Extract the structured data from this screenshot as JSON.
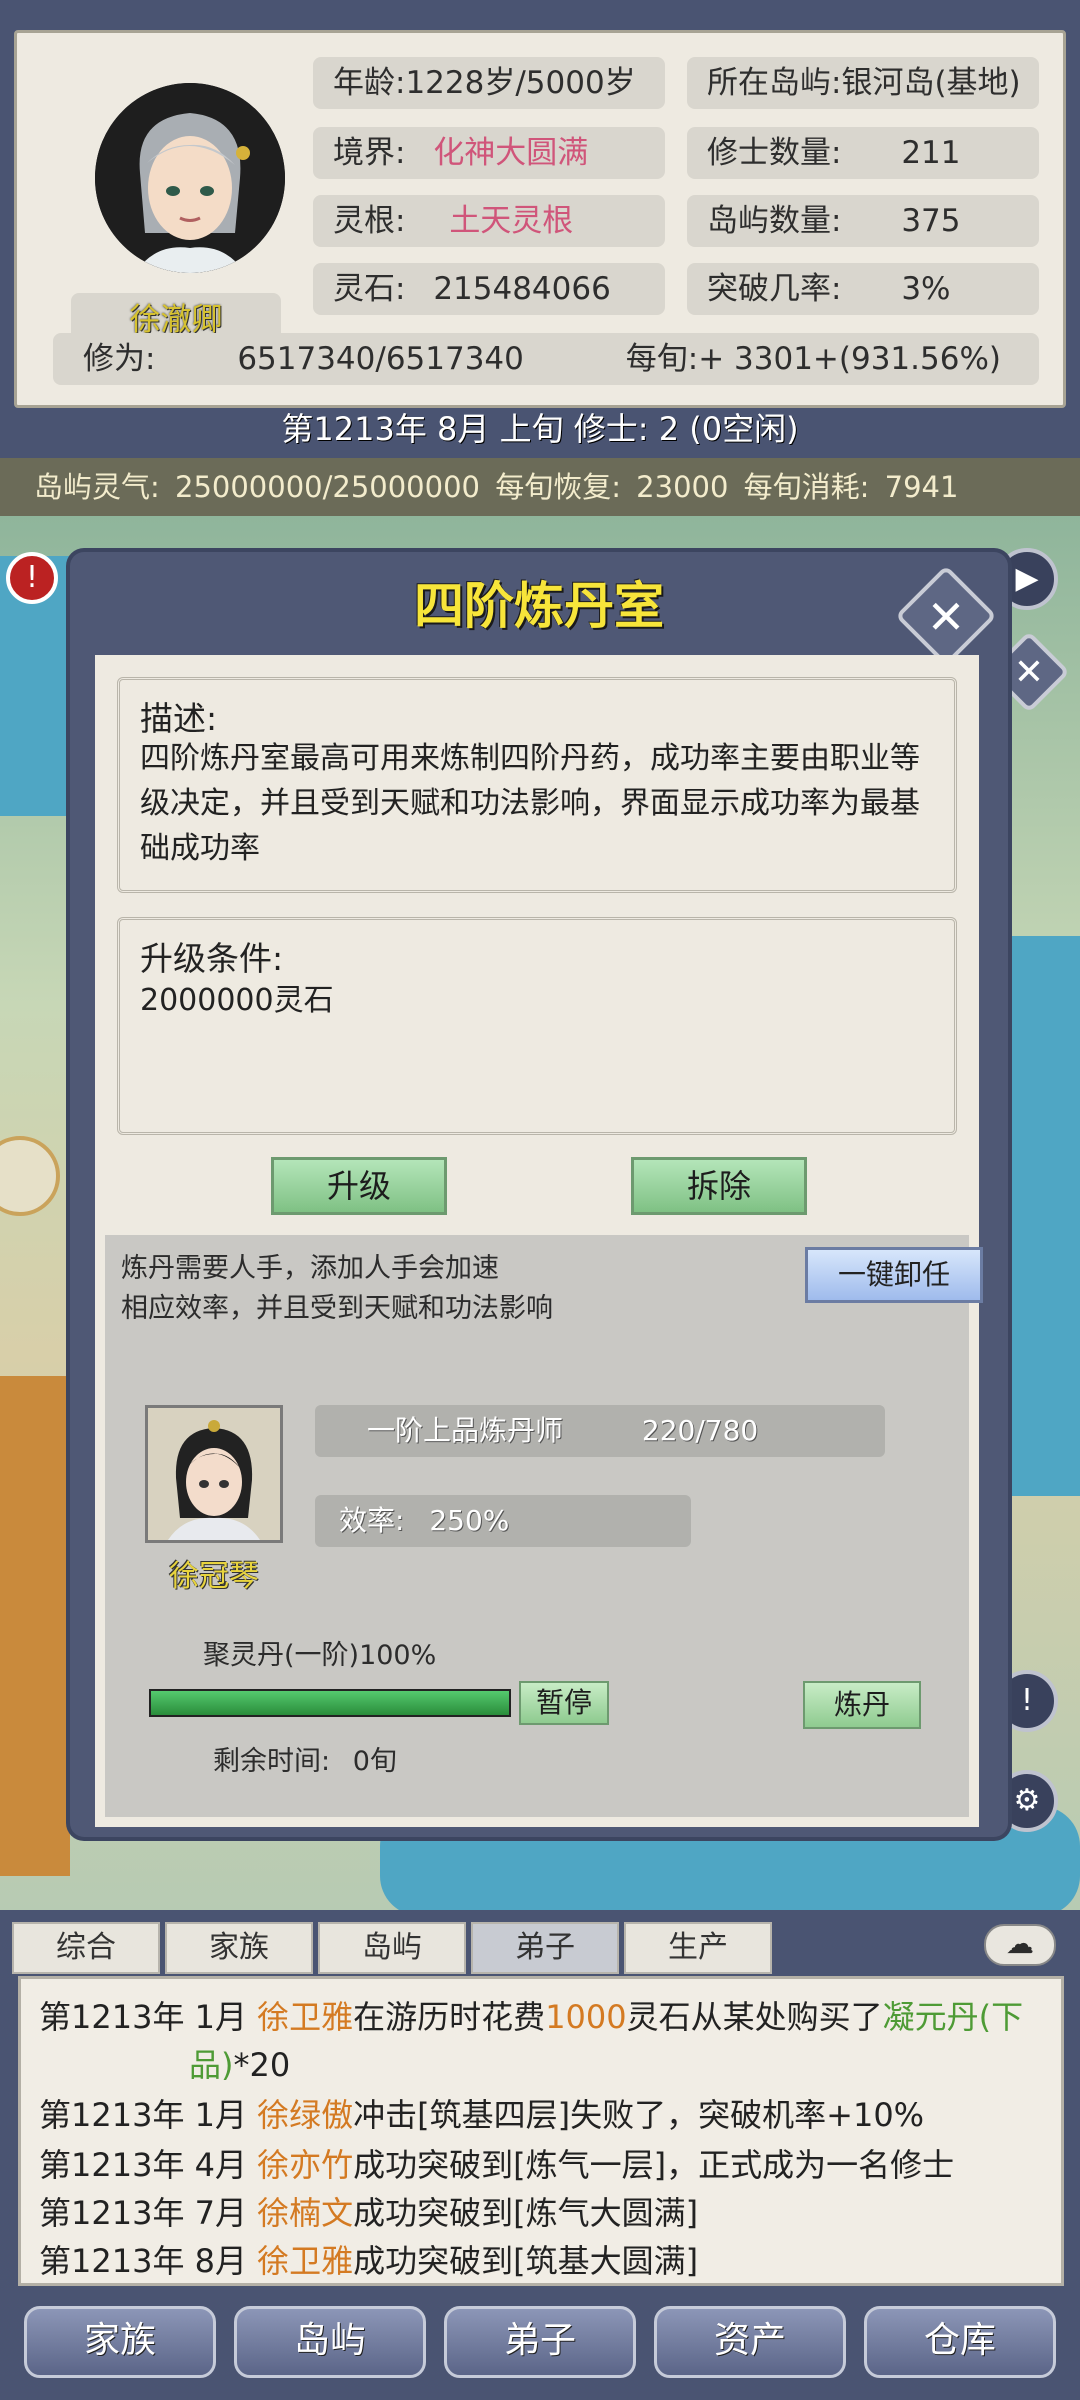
{
  "header": {
    "character_name": "徐澈卿",
    "age": "年龄:1228岁/5000岁",
    "location": "所在岛屿:银河岛(基地)",
    "realm_label": "境界:",
    "realm_value": "化神大圆满",
    "cultivator_count_label": "修士数量:",
    "cultivator_count_value": "211",
    "spirit_root_label": "灵根:",
    "spirit_root_value": "土天灵根",
    "island_count_label": "岛屿数量:",
    "island_count_value": "375",
    "spirit_stone_label": "灵石:",
    "spirit_stone_value": "215484066",
    "breakthrough_label": "突破几率:",
    "breakthrough_value": "3%",
    "cultivation_label": "修为:",
    "cultivation_value": "6517340/6517340",
    "per_period": "每旬:+ 3301+(931.56%)"
  },
  "date_line": "第1213年 8月 上旬    修士: 2 (0空闲)",
  "island_qi": "岛屿灵气: 25000000/25000000   每旬恢复: 23000  每旬消耗: 7941",
  "dialog": {
    "title": "四阶炼丹室",
    "close_symbol": "✕",
    "description_title": "描述:",
    "description_text": "四阶炼丹室最高可用来炼制四阶丹药，成功率主要由职业等级决定，并且受到天赋和功法影响，界面显示成功率为最基础成功率",
    "upgrade_title": "升级条件:",
    "upgrade_text": "2000000灵石",
    "upgrade_button": "升级",
    "demolish_button": "拆除",
    "worker_hint_1": "炼丹需要人手，添加人手会加速",
    "worker_hint_2": "相应效率，并且受到天赋和功法影响",
    "unassign_all_button": "一键卸任",
    "worker": {
      "name": "徐冠琴",
      "rank": "一阶上品炼丹师",
      "exp": "220/780",
      "efficiency_label": "效率:",
      "efficiency_value": "250%"
    },
    "task": {
      "name": "聚灵丹(一阶)100%",
      "progress": 100,
      "pause_button": "暂停",
      "remaining_label": "剩余时间:",
      "remaining_value": "0旬",
      "craft_button": "炼丹"
    }
  },
  "side_icons": [
    "play-icon",
    "close-icon",
    "alert-icon",
    "gear-icon"
  ],
  "log_tabs": [
    "综合",
    "家族",
    "岛屿",
    "弟子",
    "生产"
  ],
  "active_log_tab": "弟子",
  "log": [
    {
      "prefix": "第1213年 1月",
      "name": "徐卫雅",
      "mid": "在游历时花费",
      "num": "1000",
      "mid2": "灵石从某处购买了",
      "item": "凝元丹(下",
      "item2": "品)",
      "suffix": "*20"
    },
    {
      "prefix": "第1213年 1月",
      "name": "徐绿傲",
      "text": "冲击[筑基四层]失败了，突破机率+10%"
    },
    {
      "prefix": "第1213年 4月",
      "name": "徐亦竹",
      "text": "成功突破到[炼气一层]，正式成为一名修士"
    },
    {
      "prefix": "第1213年 7月",
      "name": "徐楠文",
      "text": "成功突破到[炼气大圆满]"
    },
    {
      "prefix": "第1213年 8月",
      "name": "徐卫雅",
      "text": "成功突破到[筑基大圆满]"
    }
  ],
  "bottom_nav": [
    "家族",
    "岛屿",
    "弟子",
    "资产",
    "仓库"
  ]
}
